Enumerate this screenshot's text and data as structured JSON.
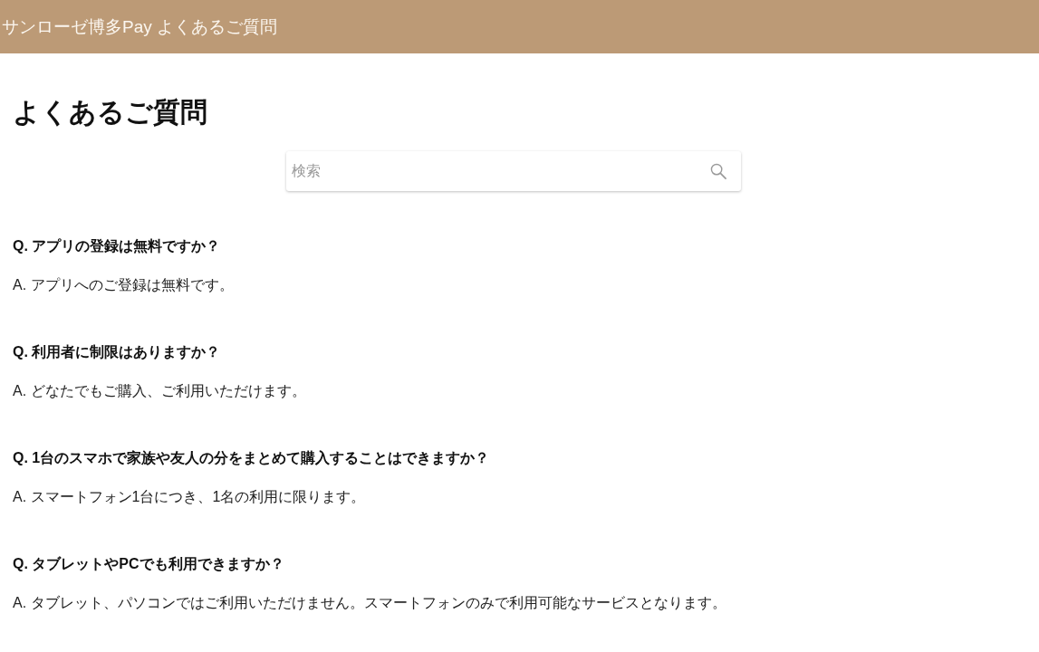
{
  "header": {
    "title": "サンローゼ博多Pay よくあるご質問"
  },
  "page": {
    "heading": "よくあるご質問"
  },
  "search": {
    "placeholder": "検索"
  },
  "faq": [
    {
      "question": "Q. アプリの登録は無料ですか？",
      "answer": "A. アプリへのご登録は無料です。"
    },
    {
      "question": "Q. 利用者に制限はありますか？",
      "answer": "A. どなたでもご購入、ご利用いただけます。"
    },
    {
      "question": "Q. 1台のスマホで家族や友人の分をまとめて購入することはできますか？",
      "answer": "A. スマートフォン1台につき、1名の利用に限ります。"
    },
    {
      "question": "Q. タブレットやPCでも利用できますか？",
      "answer": "A. タブレット、パソコンではご利用いただけません。スマートフォンのみで利用可能なサービスとなります。"
    }
  ]
}
